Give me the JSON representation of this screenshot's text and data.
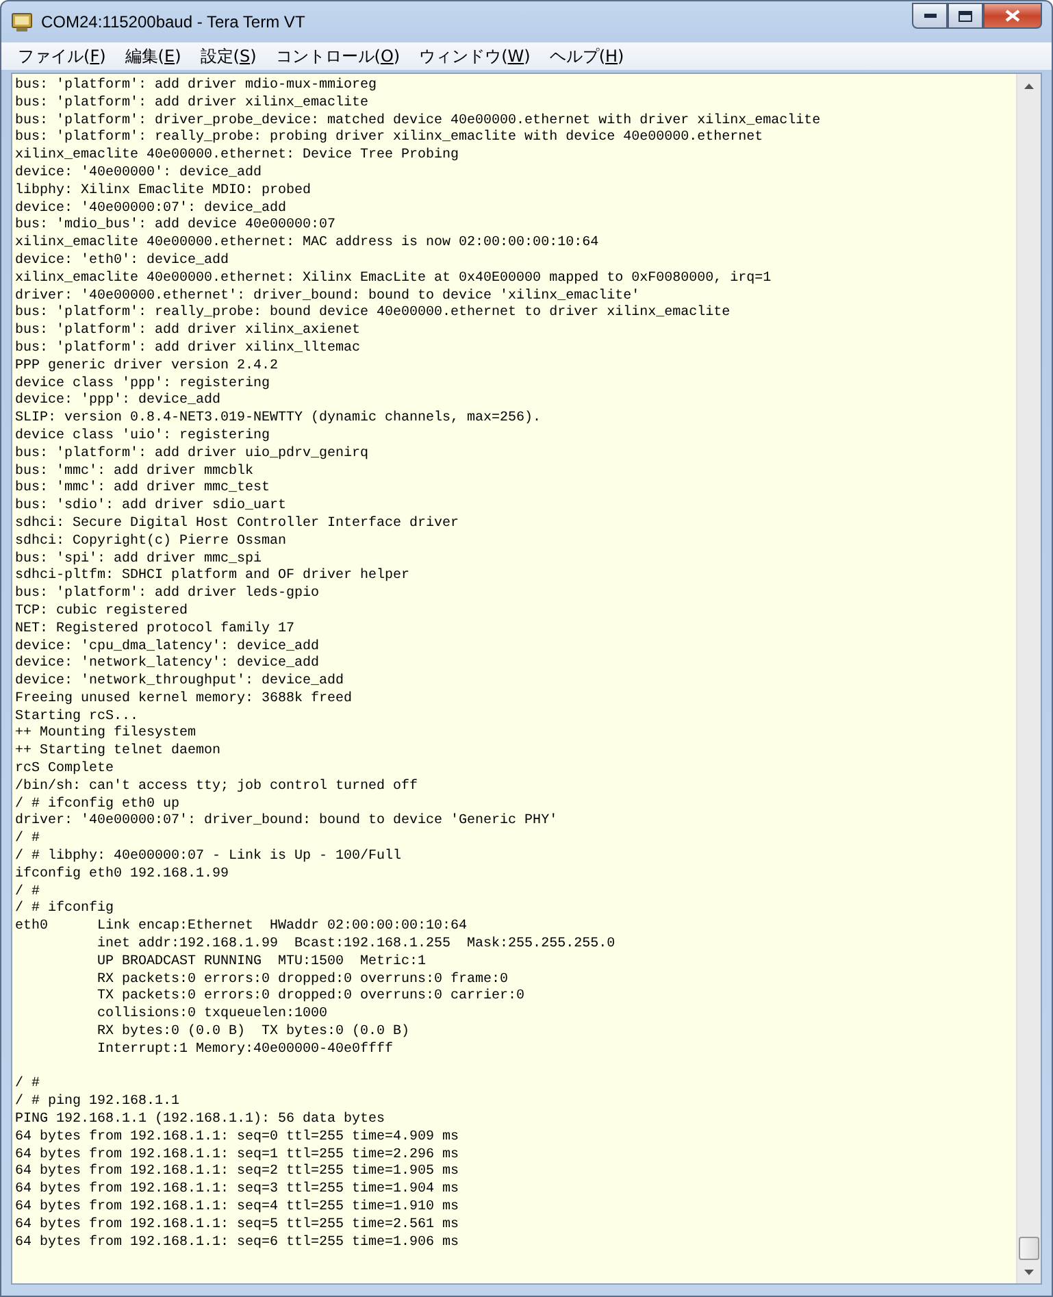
{
  "window": {
    "title": "COM24:115200baud - Tera Term VT"
  },
  "menu": [
    {
      "label": "ファイル(F)"
    },
    {
      "label": "編集(E)"
    },
    {
      "label": "設定(S)"
    },
    {
      "label": "コントロール(O)"
    },
    {
      "label": "ウィンドウ(W)"
    },
    {
      "label": "ヘルプ(H)"
    }
  ],
  "terminal": {
    "blocks": [
      {
        "lines": [
          "bus: 'platform': add driver mdio-mux-mmioreg",
          "bus: 'platform': add driver xilinx_emaclite",
          "bus: 'platform': driver_probe_device: matched device 40e00000.ethernet with driver xilinx_emaclite",
          "bus: 'platform': really_probe: probing driver xilinx_emaclite with device 40e00000.ethernet",
          "xilinx_emaclite 40e00000.ethernet: Device Tree Probing",
          "device: '40e00000': device_add",
          "libphy: Xilinx Emaclite MDIO: probed",
          "device: '40e00000:07': device_add",
          "bus: 'mdio_bus': add device 40e00000:07",
          "xilinx_emaclite 40e00000.ethernet: MAC address is now 02:00:00:00:10:64",
          "device: 'eth0': device_add",
          "xilinx_emaclite 40e00000.ethernet: Xilinx EmacLite at 0x40E00000 mapped to 0xF0080000, irq=1",
          "driver: '40e00000.ethernet': driver_bound: bound to device 'xilinx_emaclite'",
          "bus: 'platform': really_probe: bound device 40e00000.ethernet to driver xilinx_emaclite",
          "bus: 'platform': add driver xilinx_axienet",
          "bus: 'platform': add driver xilinx_lltemac",
          "PPP generic driver version 2.4.2",
          "device class 'ppp': registering",
          "device: 'ppp': device_add",
          "SLIP: version 0.8.4-NET3.019-NEWTTY (dynamic channels, max=256).",
          "device class 'uio': registering",
          "bus: 'platform': add driver uio_pdrv_genirq",
          "bus: 'mmc': add driver mmcblk",
          "bus: 'mmc': add driver mmc_test",
          "bus: 'sdio': add driver sdio_uart",
          "sdhci: Secure Digital Host Controller Interface driver",
          "sdhci: Copyright(c) Pierre Ossman",
          "bus: 'spi': add driver mmc_spi",
          "sdhci-pltfm: SDHCI platform and OF driver helper",
          "bus: 'platform': add driver leds-gpio",
          "TCP: cubic registered",
          "NET: Registered protocol family 17",
          "device: 'cpu_dma_latency': device_add",
          "device: 'network_latency': device_add",
          "device: 'network_throughput': device_add",
          "Freeing unused kernel memory: 3688k freed",
          "Starting rcS...",
          "++ Mounting filesystem",
          "++ Starting telnet daemon",
          "rcS Complete",
          "/bin/sh: can't access tty; job control turned off",
          "/ # ifconfig eth0 up",
          "driver: '40e00000:07': driver_bound: bound to device 'Generic PHY'",
          "/ #",
          "/ # libphy: 40e00000:07 - Link is Up - 100/Full",
          "ifconfig eth0 192.168.1.99",
          "/ #",
          "/ # ifconfig",
          "eth0      Link encap:Ethernet  HWaddr 02:00:00:00:10:64",
          "          inet addr:192.168.1.99  Bcast:192.168.1.255  Mask:255.255.255.0",
          "          UP BROADCAST RUNNING  MTU:1500  Metric:1",
          "          RX packets:0 errors:0 dropped:0 overruns:0 frame:0",
          "          TX packets:0 errors:0 dropped:0 overruns:0 carrier:0",
          "          collisions:0 txqueuelen:1000",
          "          RX bytes:0 (0.0 B)  TX bytes:0 (0.0 B)",
          "          Interrupt:1 Memory:40e00000-40e0ffff"
        ]
      },
      {
        "lines": [
          "/ #",
          "/ # ping 192.168.1.1",
          "PING 192.168.1.1 (192.168.1.1): 56 data bytes",
          "64 bytes from 192.168.1.1: seq=0 ttl=255 time=4.909 ms",
          "64 bytes from 192.168.1.1: seq=1 ttl=255 time=2.296 ms",
          "64 bytes from 192.168.1.1: seq=2 ttl=255 time=1.905 ms",
          "64 bytes from 192.168.1.1: seq=3 ttl=255 time=1.904 ms",
          "64 bytes from 192.168.1.1: seq=4 ttl=255 time=1.910 ms",
          "64 bytes from 192.168.1.1: seq=5 ttl=255 time=2.561 ms",
          "64 bytes from 192.168.1.1: seq=6 ttl=255 time=1.906 ms"
        ]
      }
    ]
  }
}
